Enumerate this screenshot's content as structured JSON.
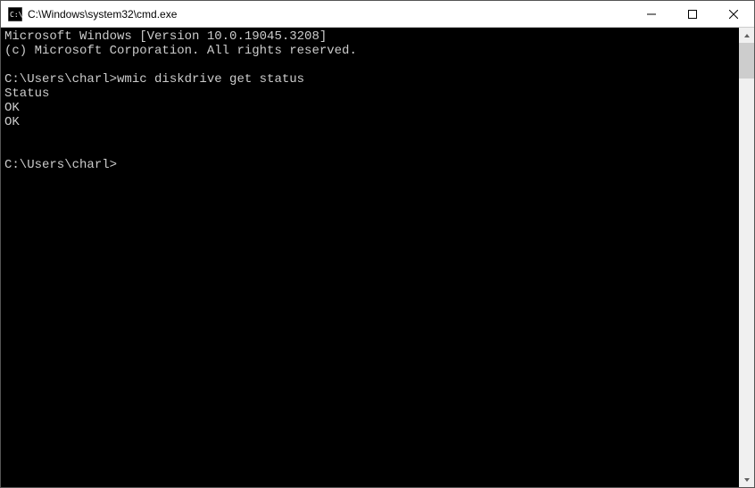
{
  "window": {
    "title": "C:\\Windows\\system32\\cmd.exe"
  },
  "terminal": {
    "lines": [
      "Microsoft Windows [Version 10.0.19045.3208]",
      "(c) Microsoft Corporation. All rights reserved.",
      "",
      "C:\\Users\\charl>wmic diskdrive get status",
      "Status",
      "OK",
      "OK",
      "",
      "",
      "C:\\Users\\charl>"
    ]
  }
}
